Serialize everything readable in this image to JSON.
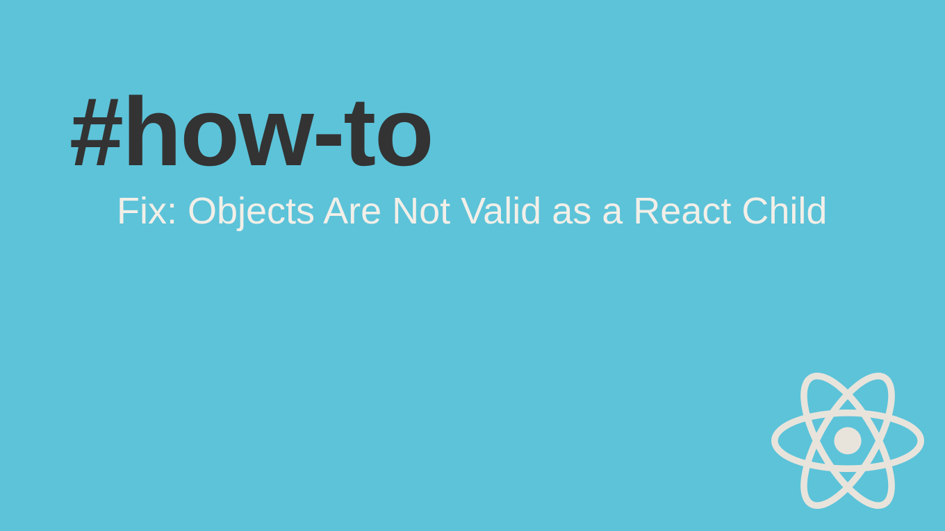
{
  "hashtag": "#how-to",
  "subtitle": "Fix: Objects Are Not Valid as a React Child",
  "colors": {
    "background": "#5cc3d9",
    "hashtag": "#333333",
    "subtitle": "#f2efe8",
    "logo": "#e8e4dc"
  }
}
